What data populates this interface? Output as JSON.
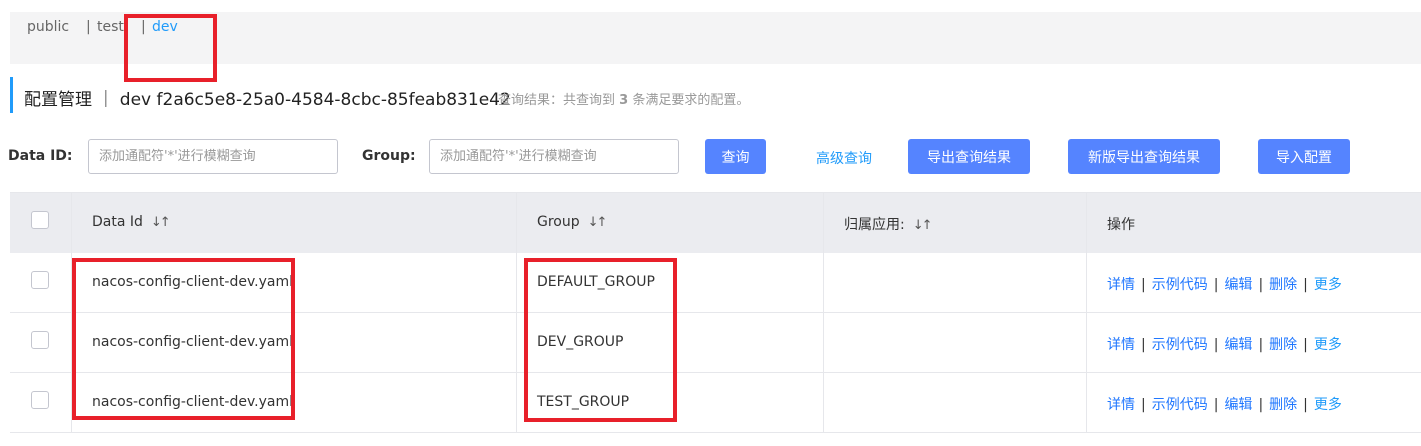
{
  "namespaces": {
    "public": "public",
    "test": "test",
    "dev": "dev",
    "separator": "|"
  },
  "header": {
    "title": "配置管理 ｜ dev  f2a6c5e8-25a0-4584-8cbc-85feab831e42",
    "result_prefix": "查询结果：共查询到",
    "result_count": "3",
    "result_suffix": "条满足要求的配置。"
  },
  "filters": {
    "data_id_label": "Data ID:",
    "data_id_placeholder": "添加通配符'*'进行模糊查询",
    "group_label": "Group:",
    "group_placeholder": "添加通配符'*'进行模糊查询"
  },
  "actions": {
    "query": "查询",
    "advanced_query": "高级查询",
    "export_results": "导出查询结果",
    "new_export_results": "新版导出查询结果",
    "import_config": "导入配置"
  },
  "table": {
    "columns": {
      "data_id": "Data Id",
      "group": "Group",
      "app": "归属应用:",
      "operations": "操作"
    },
    "sort_icon": "sort-icon",
    "rows": [
      {
        "data_id": "nacos-config-client-dev.yaml",
        "group": "DEFAULT_GROUP",
        "app": ""
      },
      {
        "data_id": "nacos-config-client-dev.yaml",
        "group": "DEV_GROUP",
        "app": ""
      },
      {
        "data_id": "nacos-config-client-dev.yaml",
        "group": "TEST_GROUP",
        "app": ""
      }
    ],
    "op_labels": {
      "details": "详情",
      "sample_code": "示例代码",
      "edit": "编辑",
      "delete": "删除",
      "more": "更多",
      "separator": "|"
    }
  },
  "colors": {
    "accent": "#209bfa",
    "button": "#5584ff",
    "link": "#2077ff",
    "highlight_box": "#e8202a"
  }
}
